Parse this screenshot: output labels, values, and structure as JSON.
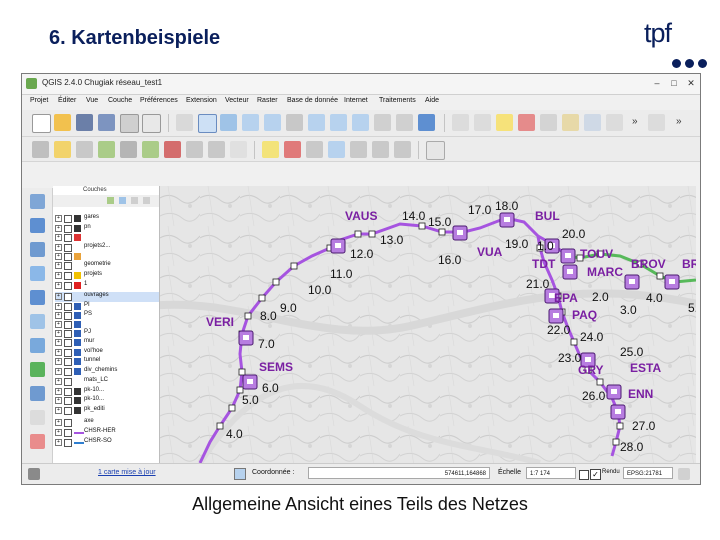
{
  "slide": {
    "title": "6. Kartenbeispiele",
    "logo": "tpf",
    "caption": "Allgemeine Ansicht eines Teils des Netzes"
  },
  "colors": {
    "title": "#0a1f5c",
    "route_line": "#a654e0",
    "station_fill": "#b77de0",
    "station_label": "#7a1fa2",
    "green_line": "#57b95a"
  },
  "app": {
    "title": "QGIS 2.4.0 Chugiak  réseau_test1",
    "menus": [
      "Projet",
      "Éditer",
      "Vue",
      "Couche",
      "Préférences",
      "Extension",
      "Vecteur",
      "Raster",
      "Base de donnée",
      "Internet",
      "Traitements",
      "Aide"
    ],
    "toolbar_overflow": "»"
  },
  "layers_panel": {
    "title": "Couches",
    "layers": [
      {
        "label": "gares",
        "symbol": "cross"
      },
      {
        "label": "pn",
        "symbol": "cross"
      },
      {
        "label": "",
        "symbol": "triangle-red"
      },
      {
        "label": "projets2...",
        "symbol": "none"
      },
      {
        "label": "",
        "symbol": "pin"
      },
      {
        "label": "geometrie",
        "symbol": "none"
      },
      {
        "label": "projets",
        "symbol": "star-yellow"
      },
      {
        "label": "1",
        "symbol": "star-red"
      },
      {
        "label": "ouvrages",
        "symbol": "none",
        "selected": true
      },
      {
        "label": "PI",
        "symbol": "blue"
      },
      {
        "label": "PS",
        "symbol": "blue"
      },
      {
        "label": "",
        "symbol": "blue"
      },
      {
        "label": "PJ",
        "symbol": "blue"
      },
      {
        "label": "mur",
        "symbol": "blue"
      },
      {
        "label": "vol'hoe",
        "symbol": "blue"
      },
      {
        "label": "tunnel",
        "symbol": "blue"
      },
      {
        "label": "div_chemins",
        "symbol": "blue"
      },
      {
        "label": "mats_LC",
        "symbol": "none"
      },
      {
        "label": "pk-10...",
        "symbol": "cross"
      },
      {
        "label": "pk-10...",
        "symbol": "cross"
      },
      {
        "label": "pk_editi",
        "symbol": "cross"
      },
      {
        "label": "axe",
        "symbol": "none"
      },
      {
        "label": "CHSR-HER",
        "symbol": "line-purple"
      },
      {
        "label": "CHSR-SO",
        "symbol": "line-blue"
      }
    ]
  },
  "map": {
    "stations": [
      {
        "label": "VAUS"
      },
      {
        "label": "BUL"
      },
      {
        "label": "VUA"
      },
      {
        "label": "TDT"
      },
      {
        "label": "TOUV"
      },
      {
        "label": "MARC"
      },
      {
        "label": "BROV"
      },
      {
        "label": "BROI"
      },
      {
        "label": "EPA"
      },
      {
        "label": "PAQ"
      },
      {
        "label": "VERI"
      },
      {
        "label": "SEMS"
      },
      {
        "label": "GRY"
      },
      {
        "label": "ESTA"
      },
      {
        "label": "ENN"
      }
    ],
    "kilometre_labels": [
      "14.0",
      "15.0",
      "17.0",
      "18.0",
      "13.0",
      "12.0",
      "11.0",
      "10.0",
      "9.0",
      "8.0",
      "7.0",
      "6.0",
      "5.0",
      "4.0",
      "16.0",
      "19.0",
      "1.0",
      "20.0",
      "21.0",
      "2.0",
      "4.0",
      "3.0",
      "5.0",
      "22.0",
      "24.0",
      "23.0",
      "25.0",
      "26.0",
      "27.0",
      "28.0"
    ]
  },
  "statusbar": {
    "message": "1 carte mise à jour",
    "coord_label": "Coordonnée :",
    "coord_value": "574611,164868",
    "scale_label": "Échelle",
    "scale_value": "1:7 174",
    "render_label": "Rendu",
    "crs": "EPSG:21781"
  }
}
